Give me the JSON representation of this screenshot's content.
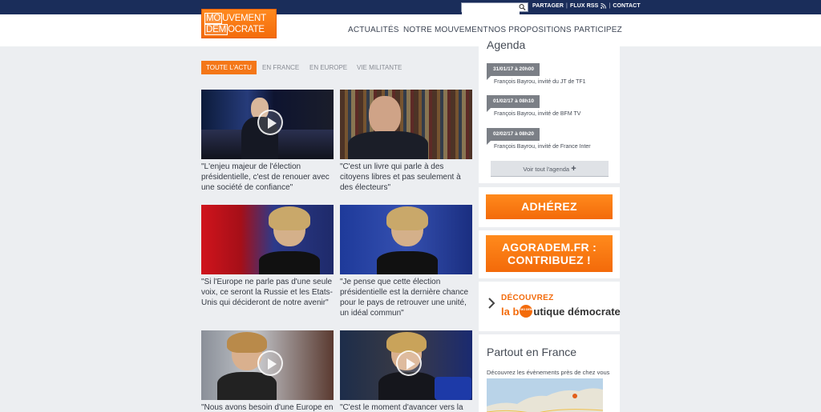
{
  "topbar": {
    "search_placeholder": "",
    "links": {
      "share": "PARTAGER",
      "rss": "FLUX RSS",
      "contact": "CONTACT",
      "separator": "|"
    }
  },
  "logo": {
    "line1_box": "MO",
    "line1_rest": "UVEMENT",
    "line2_box": "DEM",
    "line2_rest": "OCRATE"
  },
  "nav": {
    "items": [
      "ACTUALITÉS",
      "NOTRE MOUVEMENT",
      "NOS PROPOSITIONS",
      "PARTICIPEZ"
    ]
  },
  "filters": {
    "tabs": [
      "TOUTE L'ACTU",
      "EN FRANCE",
      "EN EUROPE",
      "VIE MILITANTE"
    ],
    "active_index": 0
  },
  "articles": [
    {
      "caption": "\"L'enjeu majeur de l'élection présidentielle, c'est de renouer avec une société de confiance\"",
      "has_video": true
    },
    {
      "caption": "\"C'est un livre qui parle à des citoyens libres et pas seulement à des électeurs\"",
      "has_video": false
    },
    {
      "caption": "\"Si l'Europe ne parle pas d'une seule voix, ce seront la Russie et les Etats-Unis qui décideront de notre avenir\"",
      "has_video": false
    },
    {
      "caption": "\"Je pense que cette élection présidentielle est la dernière chance pour le pays de retrouver une unité, un idéal commun\"",
      "has_video": false
    },
    {
      "caption": "\"Nous avons besoin d'une Europe en",
      "has_video": true
    },
    {
      "caption": "\"C'est le moment d'avancer vers la",
      "has_video": true
    }
  ],
  "agenda": {
    "title": "Agenda",
    "events": [
      {
        "date": "31/01/17 à 20h00",
        "text": "François Bayrou, invité du JT de TF1"
      },
      {
        "date": "01/02/17 à 08h10",
        "text": "François Bayrou, invité de BFM TV"
      },
      {
        "date": "02/02/17 à 08h20",
        "text": "François Bayrou, invité de France Inter"
      }
    ],
    "see_all": "Voir tout l'agenda",
    "see_all_icon": "+"
  },
  "cta": {
    "adherez": "ADHÉREZ",
    "agorademe_line1": "AGORADEM.FR :",
    "agorademe_line2": "CONTRIBUEZ !"
  },
  "boutique": {
    "line1": "DÉCOUVREZ",
    "line2_a": "la b",
    "line2_b": "utique démocrate"
  },
  "partout": {
    "title": "Partout en France",
    "subtitle": "Découvrez les évènements près de chez vous"
  },
  "colors": {
    "accent": "#f47718",
    "topbar": "#1a2d5a",
    "background": "#eceef1"
  }
}
